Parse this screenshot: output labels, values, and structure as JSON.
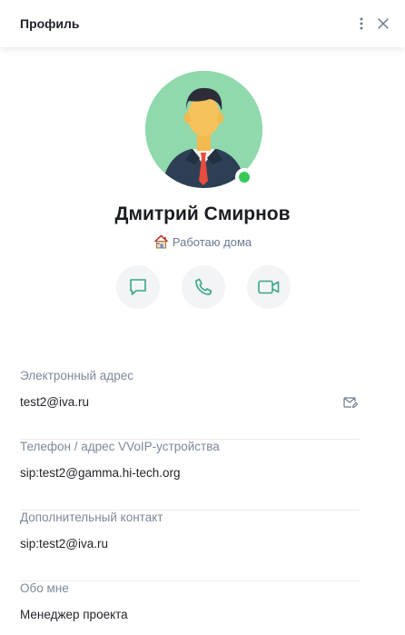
{
  "header": {
    "title": "Профиль"
  },
  "profile": {
    "name": "Дмитрий Смирнов",
    "status_text": "Работаю дома",
    "presence": "online"
  },
  "actions": [
    {
      "icon": "chat-icon"
    },
    {
      "icon": "phone-icon"
    },
    {
      "icon": "video-icon"
    }
  ],
  "fields": [
    {
      "label": "Электронный адрес",
      "value": "test2@iva.ru"
    },
    {
      "label": "Телефон / адрес VVoIP-устройства",
      "value": "sip:test2@gamma.hi-tech.org"
    },
    {
      "label": "Дополнительный контакт",
      "value": "sip:test2@iva.ru"
    },
    {
      "label": "Обо мне",
      "value": "Менеджер проекта"
    }
  ],
  "colors": {
    "accent": "#3aa58a",
    "online": "#37c95a",
    "label": "#7d8899",
    "avatar_bg": "#8fd9ac"
  }
}
